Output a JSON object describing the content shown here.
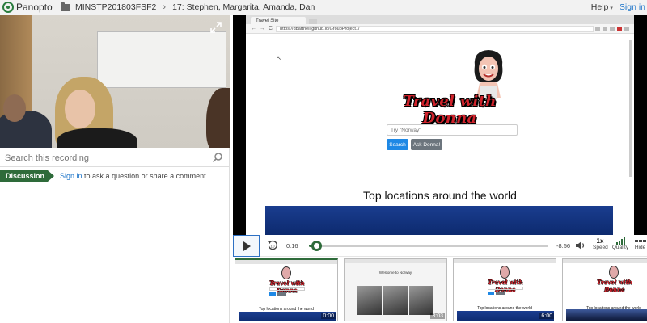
{
  "topbar": {
    "app_name": "Panopto",
    "folder": "MINSTP201803FSF2",
    "separator": "›",
    "session_title": "17: Stephen, Margarita, Amanda, Dan",
    "help_label": "Help",
    "help_caret": "▾",
    "signin_label": "Sign in"
  },
  "sidebar": {
    "search_placeholder": "Search this recording",
    "discussion_tab": "Discussion",
    "signin_link": "Sign in",
    "signin_suffix": " to ask a question or share a comment"
  },
  "browser": {
    "tab_title": "Travel Site",
    "url": "https://dbarthell.github.io/GroupProject1/",
    "back": "←",
    "forward": "→",
    "reload": "C"
  },
  "site": {
    "brand": "Travel with Donna",
    "search_placeholder": "Try \"Norway\"",
    "search_button": "Search",
    "ask_button": "Ask Donna!",
    "heading": "Top locations around the world"
  },
  "player": {
    "current_time": "0:16",
    "remaining_time": "-8:56",
    "progress_fraction": 0.03,
    "speed_value": "1x",
    "speed_label": "Speed",
    "quality_label": "Quality",
    "hide_label": "Hide"
  },
  "thumbnails": [
    {
      "kind": "home",
      "time": "0:00"
    },
    {
      "kind": "welcome",
      "time": "3:03"
    },
    {
      "kind": "home",
      "time": "6:00"
    },
    {
      "kind": "city",
      "time": ""
    }
  ],
  "thumb_text": {
    "brand": "Travel with Donna",
    "heading": "Top locations around the world",
    "welcome": "Welcome to Norway"
  },
  "colors": {
    "accent_green": "#2e6b3a",
    "link_blue": "#1a73c8",
    "brand_red": "#d0232c"
  }
}
